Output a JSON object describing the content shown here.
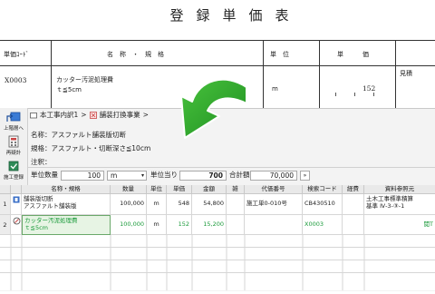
{
  "document": {
    "title": "登録単価表",
    "headers": {
      "code": "単価ｺｰﾄﾞ",
      "name_spec": "名　称　・　規　格",
      "unit": "単　位",
      "price": "単　　　価",
      "estimate": "見積"
    },
    "row": {
      "code": "X0003",
      "name": "カッター汚泥処理費",
      "spec": "ｔ≦5cm",
      "unit": "m",
      "price": "152"
    }
  },
  "app": {
    "sidebar": {
      "up_label": "上階層へ",
      "recalc_label": "再疑計",
      "register_label": "施工登録"
    },
    "breadcrumb": {
      "item1": "本工事内訳1",
      "sep": ">",
      "item2": "舗装打換事業",
      "sep2": ">"
    },
    "name_line": "名称：アスファルト舗装版切断",
    "spec_line": "規格：アスファルト・切断深さ≦10cm",
    "note_label": "注釈：",
    "qty_label": "単位数量",
    "qty_value": "100",
    "unit_value": "m",
    "per_unit_label": "単位当り",
    "per_unit_value": "700",
    "total_label": "合計額",
    "total_value": "70,000"
  },
  "grid": {
    "headers": [
      "名称・規格",
      "数量",
      "単位",
      "単価",
      "金額",
      "雑",
      "代価番号",
      "検索コード",
      "経費",
      "資料参照元"
    ],
    "rows": [
      {
        "no": "1",
        "name": "舗装版切断",
        "spec": "アスファルト舗装版",
        "qty": "100,000",
        "unit": "m",
        "price": "548",
        "amount": "54,800",
        "ref_no": "施工単0-010号",
        "code": "CB430510",
        "source1": "土木工事標準積算",
        "source2": "基準 Ⅳ-3-③-1"
      },
      {
        "no": "2",
        "name": "カッター汚泥処理費",
        "spec": "ｔ≦5cm",
        "qty": "100,000",
        "unit": "m",
        "price": "152",
        "amount": "15,200",
        "ref_no": "",
        "code": "X0003",
        "source1": "",
        "source2": "",
        "extra": "閲T"
      }
    ]
  },
  "colors": {
    "arrow": "#2fa52a",
    "accent_green": "#1a9a3a",
    "selected_row": "#e7f4e4"
  }
}
